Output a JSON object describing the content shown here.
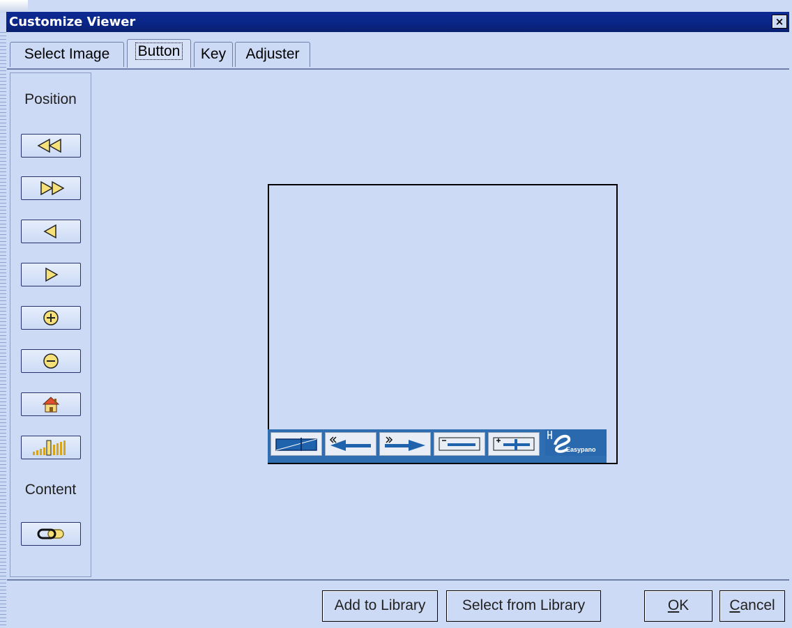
{
  "window": {
    "title": "Customize Viewer",
    "close_label": "×"
  },
  "tabs": [
    {
      "label": "Select Image"
    },
    {
      "label": "Button"
    },
    {
      "label": "Key"
    },
    {
      "label": "Adjuster"
    }
  ],
  "sidebar": {
    "position_label": "Position",
    "content_label": "Content",
    "position_buttons": [
      "rewind-icon",
      "fast-forward-icon",
      "left-arrow-icon",
      "right-arrow-icon",
      "zoom-in-icon",
      "zoom-out-icon",
      "home-icon",
      "volume-icon"
    ],
    "content_buttons": [
      "link-icon"
    ]
  },
  "preview": {
    "toolbar_buttons": [
      "move-icon",
      "pan-left-icon",
      "pan-right-icon",
      "zoom-out-bar-icon",
      "zoom-in-bar-icon"
    ],
    "brand_text": "Easypano"
  },
  "footer": {
    "add_label": "Add to Library",
    "select_label": "Select from Library",
    "ok_prefix": "",
    "ok_mnemonic": "O",
    "ok_rest": "K",
    "cancel_mnemonic": "C",
    "cancel_rest": "ancel"
  },
  "colors": {
    "titlebar": "#0c2b93",
    "window_bg": "#ccdaf5",
    "icon_yellow": "#f6e07a"
  }
}
